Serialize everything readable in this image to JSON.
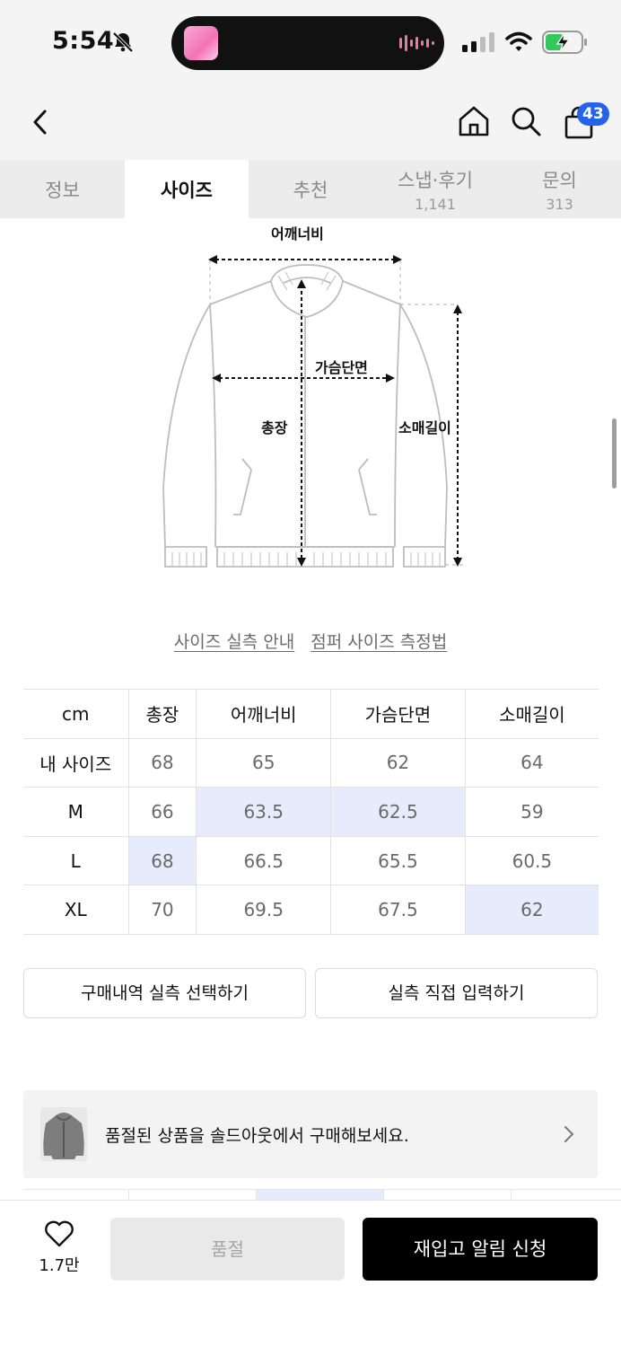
{
  "status_bar": {
    "time": "5:54"
  },
  "header": {
    "cart_count": "43"
  },
  "tabs": [
    {
      "label": "정보",
      "count": ""
    },
    {
      "label": "사이즈",
      "count": ""
    },
    {
      "label": "추천",
      "count": ""
    },
    {
      "label": "스냅·후기",
      "count": "1,141"
    },
    {
      "label": "문의",
      "count": "313"
    }
  ],
  "diagram": {
    "shoulder": "어깨너비",
    "chest": "가슴단면",
    "length": "총장",
    "sleeve": "소매길이"
  },
  "links": {
    "guide": "사이즈 실측 안내",
    "measure": "점퍼 사이즈 측정법"
  },
  "size_table": {
    "header": [
      "cm",
      "총장",
      "어깨너비",
      "가슴단면",
      "소매길이"
    ],
    "rows": [
      {
        "label": "내 사이즈",
        "values": [
          "68",
          "65",
          "62",
          "64"
        ]
      },
      {
        "label": "M",
        "values": [
          "66",
          "63.5",
          "62.5",
          "59"
        ]
      },
      {
        "label": "L",
        "values": [
          "68",
          "66.5",
          "65.5",
          "60.5"
        ]
      },
      {
        "label": "XL",
        "values": [
          "70",
          "69.5",
          "67.5",
          "62"
        ]
      }
    ]
  },
  "actions": {
    "purchase_history": "구매내역 실측 선택하기",
    "manual_input": "실측 직접 입력하기"
  },
  "banner": {
    "text": "품절된 상품을 솔드아웃에서 구매해보세요."
  },
  "bottom_bar": {
    "likes": "1.7만",
    "soldout": "품절",
    "restock": "재입고 알림 신청"
  },
  "colors": {
    "highlight": "#e6ecfb",
    "badge": "#2563eb",
    "primary_button": "#000000"
  }
}
